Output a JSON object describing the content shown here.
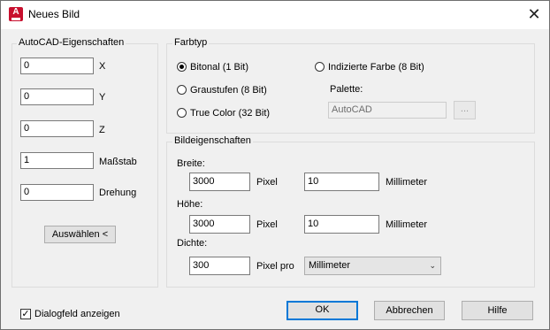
{
  "window": {
    "title": "Neues Bild",
    "close_glyph": "✕"
  },
  "autocad": {
    "legend": "AutoCAD-Eigenschaften",
    "x": {
      "label": "X",
      "value": "0"
    },
    "y": {
      "label": "Y",
      "value": "0"
    },
    "z": {
      "label": "Z",
      "value": "0"
    },
    "scale": {
      "label": "Maßstab",
      "value": "1"
    },
    "rotation": {
      "label": "Drehung",
      "value": "0"
    },
    "pick_button": "Auswählen <"
  },
  "colortype": {
    "legend": "Farbtyp",
    "options": [
      {
        "label": "Bitonal (1 Bit)",
        "checked": true
      },
      {
        "label": "Graustufen (8 Bit)",
        "checked": false
      },
      {
        "label": "True Color (32 Bit)",
        "checked": false
      },
      {
        "label": "Indizierte Farbe (8 Bit)",
        "checked": false
      }
    ],
    "palette_label": "Palette:",
    "palette_value": "AutoCAD",
    "palette_button": "..."
  },
  "image": {
    "legend": "Bildeigenschaften",
    "width": {
      "label": "Breite:",
      "pixels": "3000",
      "pixel_unit": "Pixel",
      "mm": "10",
      "mm_unit": "Millimeter"
    },
    "height": {
      "label": "Höhe:",
      "pixels": "3000",
      "pixel_unit": "Pixel",
      "mm": "10",
      "mm_unit": "Millimeter"
    },
    "density": {
      "label": "Dichte:",
      "value": "300",
      "unit": "Pixel pro",
      "selected": "Millimeter"
    }
  },
  "footer": {
    "show_dialog": {
      "label": "Dialogfeld anzeigen",
      "checked": true
    },
    "ok": "OK",
    "cancel": "Abbrechen",
    "help": "Hilfe"
  },
  "colors": {
    "accent": "#0078d7",
    "app_red": "#c8102e"
  }
}
